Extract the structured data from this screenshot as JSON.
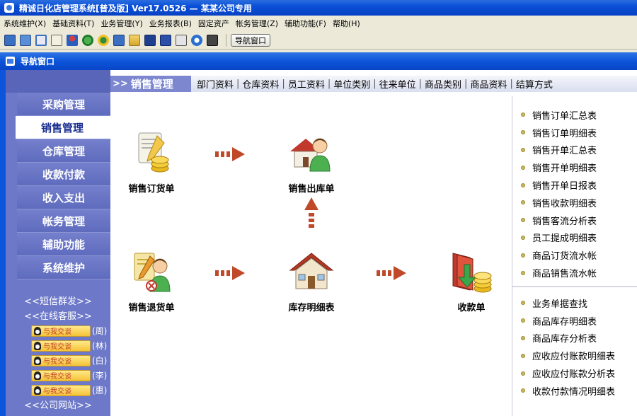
{
  "window_title": "精诚日化店管理系统[普及版] Ver17.0526 — 某某公司专用",
  "menu": [
    "系统维护(X)",
    "基础资料(T)",
    "业务管理(Y)",
    "业务报表(B)",
    "固定资产",
    "帐务管理(Z)",
    "辅助功能(F)",
    "帮助(H)"
  ],
  "toolbar": {
    "icons": [
      "grid-icon",
      "list-icon",
      "windows-icon",
      "report-icon",
      "users-icon",
      "recycle-icon",
      "money-icon",
      "export-icon",
      "folder-icon",
      "card-icon",
      "save-icon",
      "print-icon",
      "help-icon",
      "exit-icon"
    ],
    "nav_button_label": "导航窗口"
  },
  "nav_window_title": "导航窗口",
  "sidebar": {
    "items": [
      "采购管理",
      "销售管理",
      "仓库管理",
      "收款付款",
      "收入支出",
      "帐务管理",
      "辅助功能",
      "系统维护"
    ],
    "active_index": 1,
    "sms_link": "<<短信群发>>",
    "service_link": "<<在线客服>>",
    "chat_label": "与我交谈",
    "chat_contacts": [
      "(周)",
      "(林)",
      "(白)",
      "(李)",
      "(惠)"
    ],
    "website_link": "<<公司网站>>"
  },
  "header": {
    "prefix": ">>",
    "section_title": "销售管理",
    "links": [
      "部门资料",
      "仓库资料",
      "员工资料",
      "单位类别",
      "往来单位",
      "商品类别",
      "商品资料",
      "结算方式"
    ]
  },
  "flow": {
    "sales_order": "销售订货单",
    "sales_outbound": "销售出库单",
    "sales_return": "销售退货单",
    "stock_detail": "库存明细表",
    "receipt": "收款单"
  },
  "reports": {
    "group1": [
      "销售订单汇总表",
      "销售订单明细表",
      "销售开单汇总表",
      "销售开单明细表",
      "销售开单日报表",
      "销售收款明细表",
      "销售客流分析表",
      "员工提成明细表",
      "商品订货流水帐",
      "商品销售流水帐"
    ],
    "group2": [
      "业务单据查找",
      "商品库存明细表",
      "商品库存分析表",
      "应收应付账款明细表",
      "应收应付账款分析表",
      "收款付款情况明细表"
    ]
  }
}
